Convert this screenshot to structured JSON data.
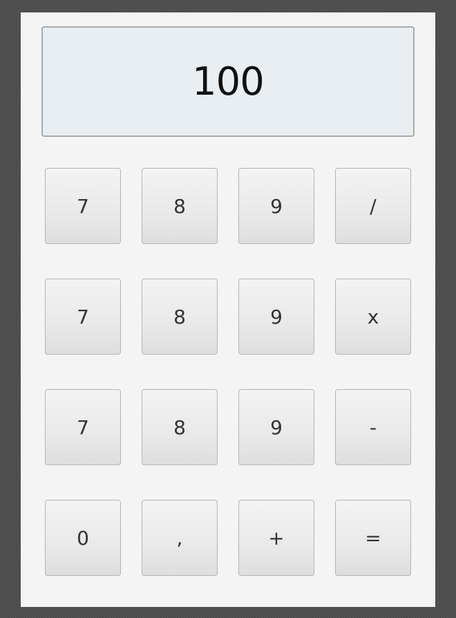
{
  "display": {
    "value": "100"
  },
  "keypad": {
    "keys": [
      {
        "label": "7"
      },
      {
        "label": "8"
      },
      {
        "label": "9"
      },
      {
        "label": "/"
      },
      {
        "label": "7"
      },
      {
        "label": "8"
      },
      {
        "label": "9"
      },
      {
        "label": "x"
      },
      {
        "label": "7"
      },
      {
        "label": "8"
      },
      {
        "label": "9"
      },
      {
        "label": "-"
      },
      {
        "label": "0"
      },
      {
        "label": ","
      },
      {
        "label": "+"
      },
      {
        "label": "="
      }
    ]
  },
  "colors": {
    "background": "#4a4a4a",
    "panel": "#f4f4f4",
    "display_bg": "#e8eef1",
    "display_border": "#a9a9a9",
    "key_border": "#b4b4b4"
  }
}
